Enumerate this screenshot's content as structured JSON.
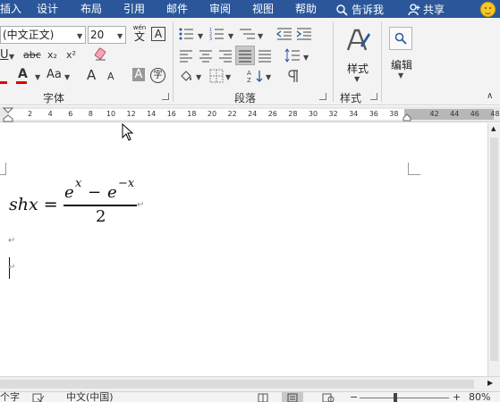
{
  "menubar": {
    "tabs": [
      "插入",
      "设计",
      "布局",
      "引用",
      "邮件",
      "审阅",
      "视图",
      "帮助"
    ],
    "search_label": "告诉我",
    "share_label": "共享"
  },
  "ribbon": {
    "font_name": "(中文正文)",
    "font_size": "20",
    "wen_label": "wén",
    "wen_char": "文",
    "a_box": "A",
    "groups": {
      "font": "字体",
      "paragraph": "段落",
      "styles": "样式"
    },
    "styles_button": "样式",
    "editing_button": "编辑",
    "font_buttons": {
      "underline": "U",
      "strike": "abc",
      "subscript": "x₂",
      "superscript": "x²",
      "font_color": "A",
      "change_case": "Aa",
      "grow": "A",
      "shrink": "A",
      "char_shade": "A",
      "enclose": "字"
    }
  },
  "ruler": {
    "ticks": [
      "2",
      "4",
      "6",
      "8",
      "10",
      "12",
      "14",
      "16",
      "18",
      "20",
      "22",
      "24",
      "26",
      "28",
      "30",
      "32",
      "34",
      "36",
      "38",
      "42",
      "44",
      "46",
      "48"
    ]
  },
  "document": {
    "formula": {
      "lhs": "shx =",
      "numerator_a": "e",
      "numerator_a_exp": "x",
      "minus": "−",
      "numerator_b": "e",
      "numerator_b_exp": "−x",
      "denominator": "2"
    },
    "para_mark": "↵"
  },
  "statusbar": {
    "word_count": "个字",
    "language": "中文(中国)",
    "zoom": "80%"
  },
  "colors": {
    "accent": "#2b579a",
    "font_color_bar": "#e00000"
  }
}
